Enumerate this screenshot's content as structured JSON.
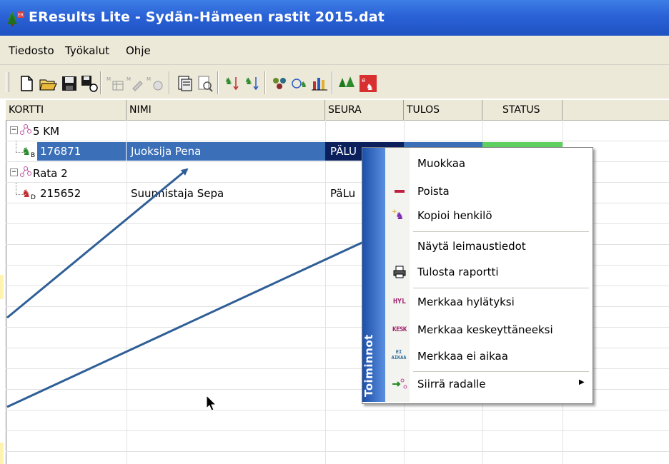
{
  "window": {
    "title": "EResults Lite - Sydän-Hämeen rastit 2015.dat"
  },
  "menu": [
    "Tiedosto",
    "Työkalut",
    "Ohje"
  ],
  "grid": {
    "columns": [
      "KORTTI",
      "NIMI",
      "SEURA",
      "TULOS",
      "STATUS"
    ],
    "groups": [
      {
        "label": "5 KM",
        "rows": [
          {
            "card": "176871",
            "name": "Juoksija Pena",
            "club": "PÄLU",
            "selected": true
          }
        ]
      },
      {
        "label": "Rata 2",
        "rows": [
          {
            "card": "215652",
            "name": "Suunnistaja Sepa",
            "club": "PäLu",
            "selected": false
          }
        ]
      }
    ]
  },
  "context_menu": {
    "side_label": "Toiminnot",
    "items": [
      {
        "label": "Muokkaa",
        "icon": "none"
      },
      {
        "label": "Poista",
        "icon": "minus-icon"
      },
      {
        "label": "Kopioi henkilö",
        "icon": "copy-person-icon"
      },
      {
        "label": "Näytä leimaustiedot",
        "icon": "none"
      },
      {
        "label": "Tulosta raportti",
        "icon": "printer-icon"
      },
      {
        "label": "Merkkaa hylätyksi",
        "icon": "hyl-icon",
        "icon_text": "HYL"
      },
      {
        "label": "Merkkaa keskeyttäneeksi",
        "icon": "kesk-icon",
        "icon_text": "KESK"
      },
      {
        "label": "Merkkaa ei aikaa",
        "icon": "ei-aikaa-icon",
        "icon_text": "EI AIKAA"
      },
      {
        "label": "Siirrä radalle",
        "icon": "move-course-icon"
      }
    ]
  },
  "colors": {
    "titlebar": "#2a62d6",
    "selection": "#3b6fb8",
    "annotation_arrow": "#2f5f96",
    "strip": "#1c4fa8"
  }
}
